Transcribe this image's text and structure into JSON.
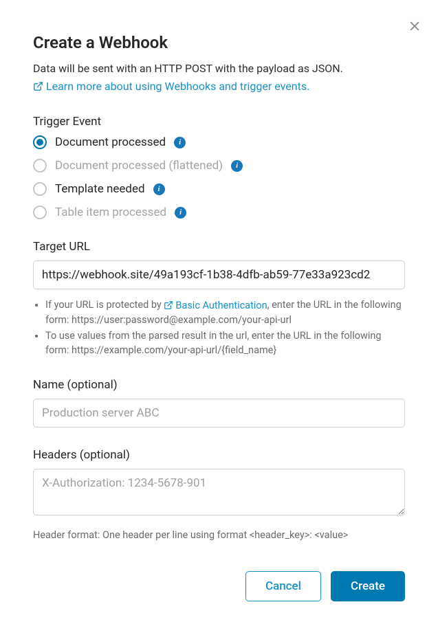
{
  "modal": {
    "title": "Create a Webhook",
    "description": "Data will be sent with an HTTP POST with the payload as JSON.",
    "learn_more": "Learn more about using Webhooks and trigger events."
  },
  "trigger": {
    "label": "Trigger Event",
    "options": [
      {
        "label": "Document processed",
        "selected": true,
        "disabled": false
      },
      {
        "label": "Document processed (flattened)",
        "selected": false,
        "disabled": true
      },
      {
        "label": "Template needed",
        "selected": false,
        "disabled": false
      },
      {
        "label": "Table item processed",
        "selected": false,
        "disabled": true
      }
    ]
  },
  "target_url": {
    "label": "Target URL",
    "value": "https://webhook.site/49a193cf-1b38-4dfb-ab59-77e33a923cd2",
    "help1_prefix": "If your URL is protected by ",
    "help1_link": "Basic Authentication",
    "help1_suffix": ", enter the URL in the following form: https://user:password@example.com/your-api-url",
    "help2": "To use values from the parsed result in the url, enter the URL in the following form: https://example.com/your-api-url/{field_name}"
  },
  "name": {
    "label": "Name (optional)",
    "placeholder": "Production server ABC",
    "value": ""
  },
  "headers": {
    "label": "Headers (optional)",
    "placeholder": "X-Authorization: 1234-5678-901",
    "value": "",
    "format_hint": "Header format: One header per line using format <header_key>: <value>"
  },
  "buttons": {
    "cancel": "Cancel",
    "create": "Create"
  }
}
